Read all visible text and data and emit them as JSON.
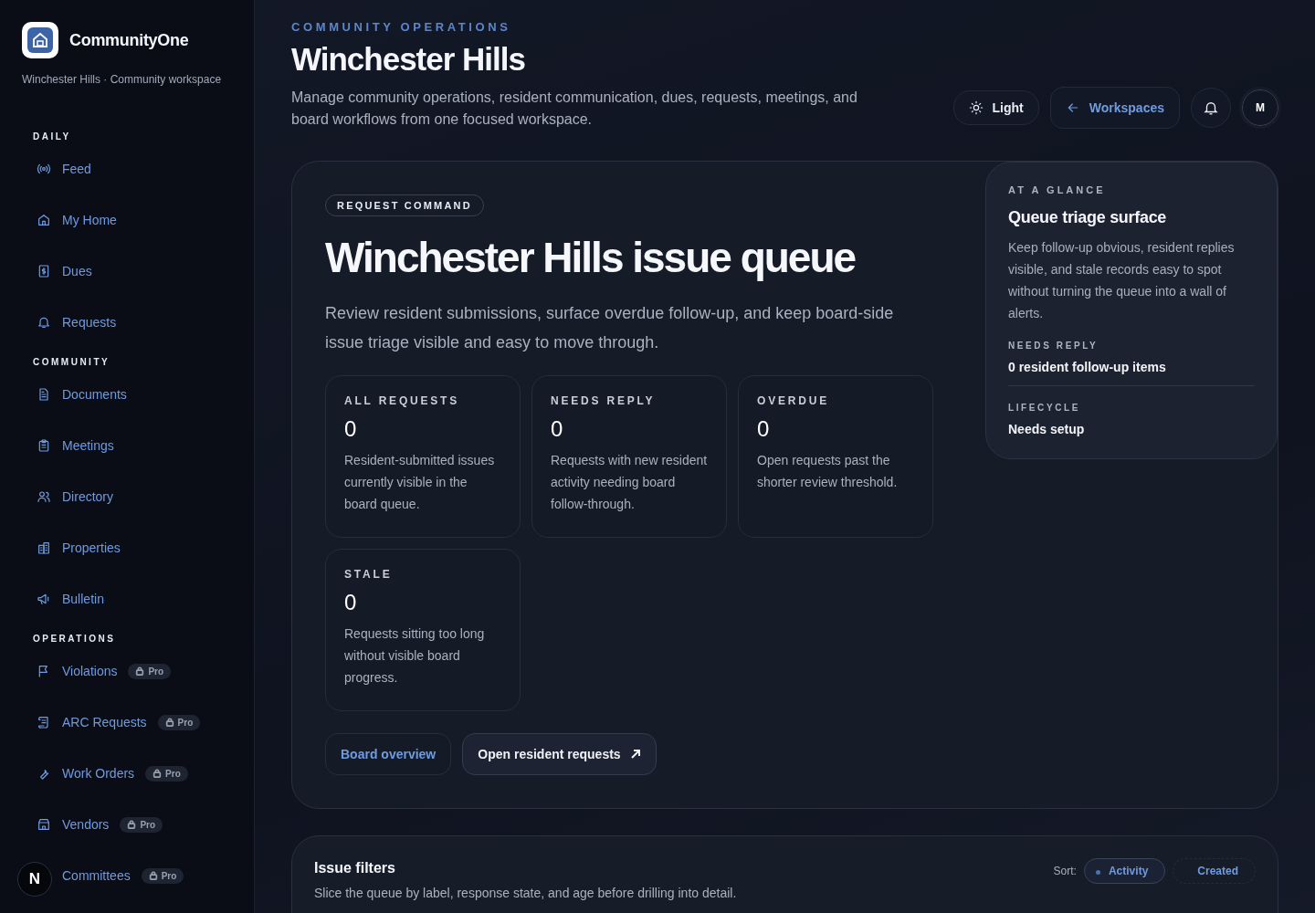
{
  "brand": {
    "name": "CommunityOne",
    "subtitle": "Winchester Hills · Community workspace"
  },
  "sidebar": {
    "sections": [
      {
        "title": "DAILY",
        "items": [
          {
            "label": "Feed"
          },
          {
            "label": "My Home"
          },
          {
            "label": "Dues"
          },
          {
            "label": "Requests"
          }
        ]
      },
      {
        "title": "COMMUNITY",
        "items": [
          {
            "label": "Documents"
          },
          {
            "label": "Meetings"
          },
          {
            "label": "Directory"
          },
          {
            "label": "Properties"
          },
          {
            "label": "Bulletin"
          }
        ]
      },
      {
        "title": "OPERATIONS",
        "items": [
          {
            "label": "Violations",
            "badge": "Pro"
          },
          {
            "label": "ARC Requests",
            "badge": "Pro"
          },
          {
            "label": "Work Orders",
            "badge": "Pro"
          },
          {
            "label": "Vendors",
            "badge": "Pro"
          },
          {
            "label": "Committees",
            "badge": "Pro"
          }
        ]
      }
    ]
  },
  "dev_badge": "N",
  "header": {
    "eyebrow": "COMMUNITY OPERATIONS",
    "title": "Winchester Hills",
    "description": "Manage community operations, resident communication, dues, requests, meetings, and board workflows from one focused workspace.",
    "theme_button": "Light",
    "workspaces_button": "Workspaces",
    "avatar": "M"
  },
  "hero": {
    "tag": "REQUEST COMMAND",
    "title": "Winchester Hills issue queue",
    "description": "Review resident submissions, surface overdue follow-up, and keep board-side issue triage visible and easy to move through.",
    "stats": [
      {
        "label": "ALL REQUESTS",
        "value": "0",
        "note": "Resident-submitted issues currently visible in the board queue."
      },
      {
        "label": "NEEDS REPLY",
        "value": "0",
        "note": "Requests with new resident activity needing board follow-through."
      },
      {
        "label": "OVERDUE",
        "value": "0",
        "note": "Open requests past the shorter review threshold."
      },
      {
        "label": "STALE",
        "value": "0",
        "note": "Requests sitting too long without visible board progress."
      }
    ],
    "buttons": [
      {
        "label": "Board overview",
        "kind": "secondary"
      },
      {
        "label": "Open resident requests",
        "kind": "primary"
      }
    ]
  },
  "glance": {
    "eyebrow": "AT A GLANCE",
    "title": "Queue triage surface",
    "description": "Keep follow-up obvious, resident replies visible, and stale records easy to spot without turning the queue into a wall of alerts.",
    "facts": [
      {
        "label": "NEEDS REPLY",
        "value": "0 resident follow-up items"
      },
      {
        "label": "LIFECYCLE",
        "value": "Needs setup"
      }
    ]
  },
  "filters": {
    "title": "Issue filters",
    "description": "Slice the queue by label, response state, and age before drilling into detail.",
    "sort_label": "Sort:",
    "sort_options": [
      {
        "label": "Activity",
        "selected": true
      },
      {
        "label": "Created",
        "selected": false
      }
    ]
  }
}
